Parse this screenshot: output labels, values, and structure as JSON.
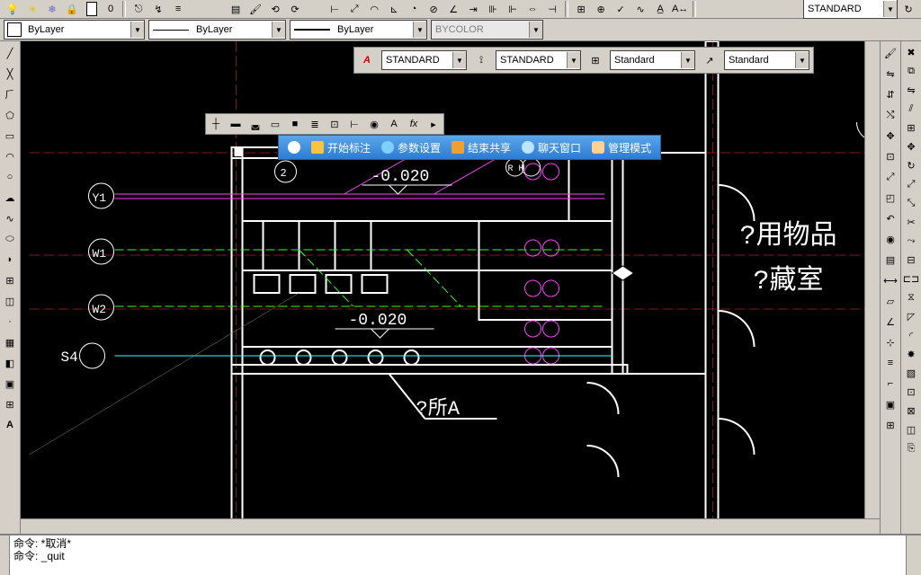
{
  "top_icons": [
    "light-bulb-icon",
    "sun-icon",
    "freeze-icon",
    "lock-icon",
    "layer-state-icon",
    "layer0-icon"
  ],
  "layer_value": "0",
  "top_right_combo": "STANDARD",
  "layer_row": {
    "layer_combo": "ByLayer",
    "linetype_combo": "ByLayer",
    "lineweight_combo": "ByLayer",
    "color_combo": "BYCOLOR"
  },
  "style_bars": {
    "text_style": "STANDARD",
    "dim_style": "STANDARD",
    "table_style": "Standard",
    "mleader_style": "Standard"
  },
  "blue_bar": {
    "start": "开始标注",
    "params": "参数设置",
    "end_share": "结束共享",
    "chat": "聊天窗口",
    "admin": "管理模式"
  },
  "drawing": {
    "elev1": "-0.020",
    "elev2": "-0.020",
    "label_y1": "Y1",
    "label_w1": "W1",
    "label_w2": "W2",
    "label_s4": "S4",
    "room_a": "?所A",
    "room_right_1": "?用物品",
    "room_right_2": "?藏室",
    "bubble_2": "2",
    "bubble_rh": "R H"
  },
  "cmd": {
    "line1": "命令: *取消*",
    "line2": "命令: _quit"
  },
  "left_tools": [
    "line-icon",
    "xline-icon",
    "pline-icon",
    "polygon-icon",
    "rect-icon",
    "arc-icon",
    "circle-icon",
    "revcloud-icon",
    "spline-icon",
    "ellipse-icon",
    "ellipse-arc-icon",
    "block-icon",
    "point-icon",
    "hatch-icon",
    "gradient-icon",
    "region-icon",
    "table-icon",
    "text-icon"
  ],
  "right_tools_a": [
    "pan-icon",
    "zoom-icon",
    "zoom-window-icon",
    "mirror3d-icon",
    "3dorbit-icon",
    "ucs-icon",
    "ucs-prev-icon",
    "view-icon",
    "named-views-icon",
    "layers-icon",
    "dim-icon",
    "leader-icon",
    "tolerance-icon",
    "center-icon",
    "dim-edit-icon",
    "dim-update-icon"
  ],
  "right_tools_b": [
    "erase-icon",
    "copy-icon",
    "mirror-icon",
    "offset-icon",
    "array-icon",
    "move-icon",
    "rotate-icon",
    "scale-icon",
    "stretch-icon",
    "trim-icon",
    "extend-icon",
    "break-icon",
    "join-icon",
    "chamfer-icon",
    "fillet-icon",
    "explode-icon",
    "draworder-icon",
    "group-icon",
    "ungroup-icon",
    "block-edit-icon",
    "insert-icon",
    "xref-icon"
  ]
}
